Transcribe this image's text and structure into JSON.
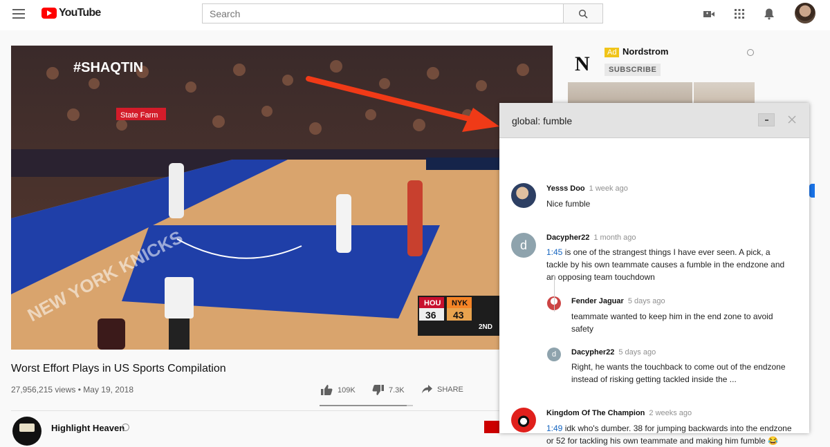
{
  "header": {
    "logo_text": "YouTube",
    "search_placeholder": "Search"
  },
  "video": {
    "overlay_tag": "#SHAQTIN",
    "court_text": "NEW YORK KNICKS",
    "sponsor": "State Farm",
    "scoreboard": {
      "home": "HOU",
      "away": "NYK",
      "home_score": "36",
      "away_score": "43",
      "period": "2ND"
    },
    "title": "Worst Effort Plays in US Sports Compilation",
    "views": "27,956,215 views",
    "date": "May 19, 2018",
    "likes": "109K",
    "dislikes": "7.3K",
    "share_label": "SHARE",
    "like_ratio": 0.937
  },
  "channel": {
    "name": "Highlight Heaven"
  },
  "ad": {
    "logo_letter": "N",
    "badge": "Ad",
    "name": "Nordstrom",
    "subscribe_label": "SUBSCRIBE"
  },
  "popup": {
    "title": "global: fumble",
    "comments": [
      {
        "author": "Yesss Doo",
        "time": "1 week ago",
        "text": "Nice fumble"
      },
      {
        "author": "Dacypher22",
        "time": "1 month ago",
        "avatar_letter": "d",
        "timestamp": "1:45",
        "text_rest": " is one of the strangest things I have ever seen. A pick, a tackle by his own teammate causes a fumble in the endzone and an opposing team touchdown"
      },
      {
        "author": "Fender Jaguar",
        "time": "5 days ago",
        "text": "teammate wanted to keep him in the end zone to avoid safety"
      },
      {
        "author": "Dacypher22",
        "time": "5 days ago",
        "avatar_letter": "d",
        "text": "Right, he wants the touchback to come out of the endzone instead of risking getting tackled inside the ..."
      },
      {
        "author": "Kingdom Of The Champion",
        "time": "2 weeks ago",
        "timestamp": "1:49",
        "text_rest": " idk who's dumber. 38 for jumping backwards into the endzone or 52 for tackling his own teammate and making him fumble 😂"
      }
    ]
  }
}
